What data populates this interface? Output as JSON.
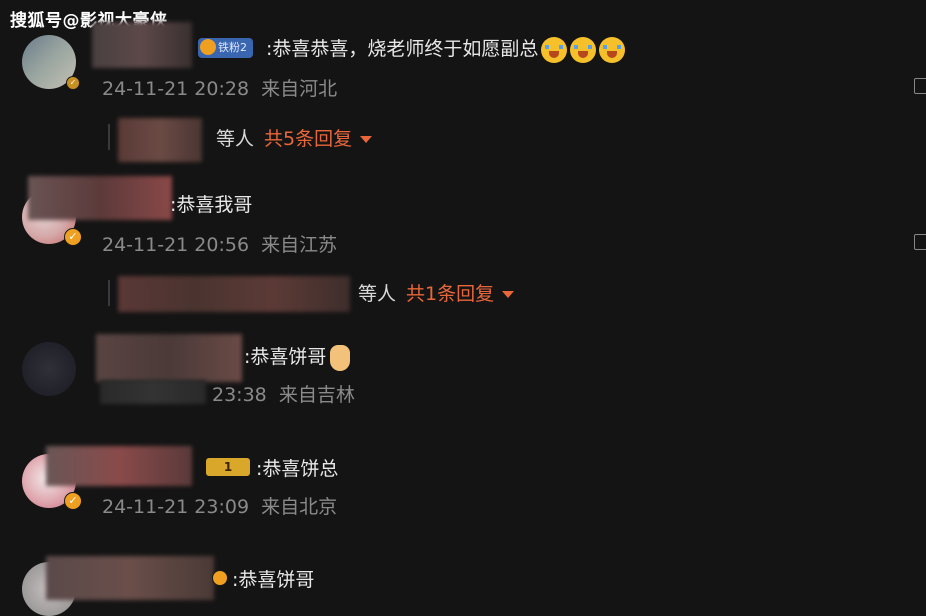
{
  "watermark": "搜狐号@影视大豪侠",
  "comments": [
    {
      "text": ":恭喜恭喜，烧老师终于如愿副总",
      "time": "24-11-21 20:28",
      "location": "来自河北",
      "badge_label": "铁粉2",
      "reply_names_suffix": "等人",
      "reply_count": "共5条回复"
    },
    {
      "text": ":恭喜我哥",
      "time": "24-11-21 20:56",
      "location": "来自江苏",
      "reply_names_suffix": "等人",
      "reply_count": "共1条回复"
    },
    {
      "text": ":恭喜饼哥",
      "time": "23:38",
      "location": "来自吉林"
    },
    {
      "text": ":恭喜饼总",
      "time": "24-11-21 23:09",
      "location": "来自北京",
      "badge_label": "1"
    },
    {
      "text": ":恭喜饼哥"
    }
  ]
}
